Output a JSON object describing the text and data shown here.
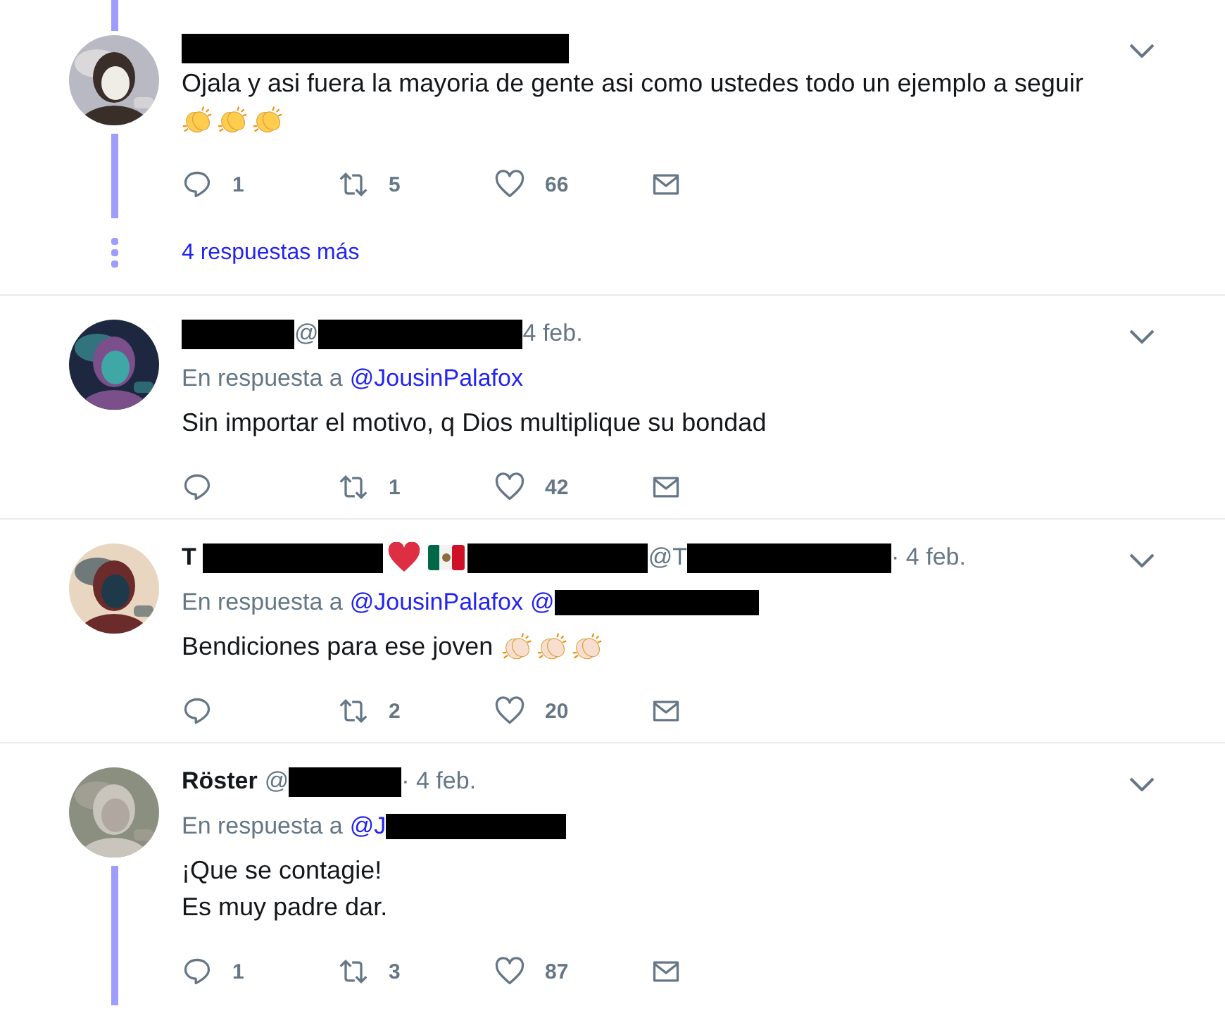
{
  "tweets": [
    {
      "thread_above": true,
      "thread_below": true,
      "header": [
        {
          "kind": "bar_xl"
        }
      ],
      "body": [
        {
          "text": "Ojala y asi fuera la mayoria de gente asi como ustedes todo un ejemplo a seguir"
        },
        {
          "emojis": [
            {
              "kind": "clap",
              "color": "#ffcc4d"
            },
            {
              "kind": "clap",
              "color": "#ffcc4d"
            },
            {
              "kind": "clap",
              "color": "#ffcc4d"
            }
          ]
        }
      ],
      "actions": [
        {
          "kind": "reply",
          "count": "1"
        },
        {
          "kind": "retweet",
          "count": "5"
        },
        {
          "kind": "like",
          "count": "66"
        },
        {
          "kind": "message"
        }
      ],
      "more_replies": "4 respuestas más"
    },
    {
      "thread_above": false,
      "thread_below": false,
      "header": [
        {
          "kind": "bar_s"
        },
        {
          "kind": "meta",
          "text": "@"
        },
        {
          "kind": "bar_l"
        },
        {
          "kind": "meta",
          "text": "4 feb."
        }
      ],
      "reply_to": {
        "label": "En respuesta a",
        "items": [
          {
            "kind": "mention",
            "text": "@JousinPalafox"
          }
        ]
      },
      "body": [
        {
          "text": "Sin importar el motivo, q Dios multiplique su bondad"
        }
      ],
      "actions": [
        {
          "kind": "reply"
        },
        {
          "kind": "retweet",
          "count": "1"
        },
        {
          "kind": "like",
          "count": "42"
        },
        {
          "kind": "message"
        }
      ]
    },
    {
      "thread_above": false,
      "thread_below": false,
      "header": [
        {
          "kind": "name",
          "text": "T"
        },
        {
          "kind": "bar_m"
        },
        {
          "kind": "heart"
        },
        {
          "kind": "flag"
        },
        {
          "kind": "bar_m"
        },
        {
          "kind": "meta",
          "text": "@T"
        },
        {
          "kind": "bar_l"
        },
        {
          "kind": "meta",
          "text": "· 4 feb."
        }
      ],
      "reply_to": {
        "label": "En respuesta a",
        "items": [
          {
            "kind": "mention",
            "text": "@JousinPalafox"
          },
          {
            "kind": "mention",
            "text": "@"
          },
          {
            "kind": "bar_l"
          }
        ]
      },
      "body": [
        {
          "text": "Bendiciones para ese joven",
          "emojis": [
            {
              "kind": "clap",
              "color": "#f7dece"
            },
            {
              "kind": "clap",
              "color": "#f7dece"
            },
            {
              "kind": "clap",
              "color": "#f7dece"
            }
          ]
        }
      ],
      "actions": [
        {
          "kind": "reply"
        },
        {
          "kind": "retweet",
          "count": "2"
        },
        {
          "kind": "like",
          "count": "20"
        },
        {
          "kind": "message"
        }
      ]
    },
    {
      "thread_above": false,
      "thread_below": true,
      "header": [
        {
          "kind": "name",
          "text": "Röster"
        },
        {
          "kind": "meta",
          "text": "@"
        },
        {
          "kind": "bar_s"
        },
        {
          "kind": "meta",
          "text": "· 4 feb."
        }
      ],
      "reply_to": {
        "label": "En respuesta a",
        "items": [
          {
            "kind": "mention",
            "text": "@J"
          },
          {
            "kind": "bar_m"
          }
        ]
      },
      "body": [
        {
          "text": "¡Que se contagie!"
        },
        {
          "text": "Es muy padre dar."
        }
      ],
      "actions": [
        {
          "kind": "reply",
          "count": "1"
        },
        {
          "kind": "retweet",
          "count": "3"
        },
        {
          "kind": "like",
          "count": "87"
        },
        {
          "kind": "message"
        }
      ]
    }
  ]
}
